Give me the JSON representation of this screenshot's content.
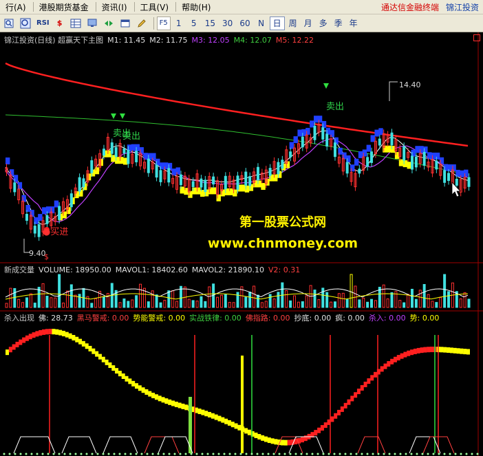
{
  "menubar": {
    "items": [
      "行(A)",
      "港股期货基金",
      "资讯(I)",
      "工具(V)",
      "帮助(H)"
    ],
    "brand_a": "通达信金融终端",
    "brand_b": "锦江投资"
  },
  "toolbar": {
    "icon_buttons": [
      "zoom-icon",
      "search-icon",
      "RSI",
      "$",
      "grid-icon",
      "monitor-icon",
      "arrows-icon",
      "window-icon",
      "pencil-icon",
      "F5"
    ],
    "rsi_label": "RSI",
    "dollar_label": "$",
    "f5_label": "F5",
    "periods": [
      "1",
      "5",
      "15",
      "30",
      "60",
      "N",
      "日",
      "周",
      "月",
      "多",
      "季",
      "年"
    ],
    "active_period": "日"
  },
  "main_legend": {
    "title": "锦江投资(日线) 超赢天下主图",
    "m1": "M1: 11.45",
    "m2": "M2: 11.75",
    "m3": "M3: 12.05",
    "m4": "M4: 12.07",
    "m5": "M5: 12.22",
    "colors": {
      "m1": "#e0e0e0",
      "m2": "#e0e0e0",
      "m3": "#c040ff",
      "m4": "#40d040",
      "m5": "#ff4040"
    }
  },
  "volume_legend": {
    "title": "新成交量",
    "volume": "VOLUME: 18950.00",
    "mavol1": "MAVOL1: 18402.60",
    "mavol2": "MAVOL2: 21890.10",
    "v2": "V2: 0.31"
  },
  "indicator_legend": {
    "title": "杀入出现",
    "fo": "佛: 28.73",
    "heima": "黑马警戒: 0.00",
    "shinen": "势能警戒: 0.00",
    "shizhan": "实战铁律: 0.00",
    "fozhi": "佛指路: 0.00",
    "chaodi": "抄底: 0.00",
    "feng": "疯: 0.00",
    "sharu": "杀入: 0.00",
    "shi": "势: 0.00"
  },
  "annotations": {
    "high_price": "14.40",
    "low_price": "9.40",
    "buy": "●买进",
    "sell1": "卖出",
    "sell2": "卖出",
    "sell3": "卖出",
    "dollar": "$"
  },
  "watermark": {
    "line1": "第一股票公式网",
    "line2": "www.chnmoney.com"
  },
  "chart_data": {
    "type": "candlestick",
    "title": "锦江投资(日线) 超赢天下主图",
    "high_label": 14.4,
    "low_label": 9.4,
    "moving_averages": [
      {
        "name": "M1",
        "last": 11.45
      },
      {
        "name": "M2",
        "last": 11.75
      },
      {
        "name": "M3",
        "last": 12.05
      },
      {
        "name": "M4",
        "last": 12.07
      },
      {
        "name": "M5",
        "last": 12.22
      }
    ],
    "volume": {
      "last": 18950.0,
      "mavol1": 18402.6,
      "mavol2": 21890.1,
      "v2": 0.31
    },
    "indicator": {
      "fo": 28.73
    }
  }
}
